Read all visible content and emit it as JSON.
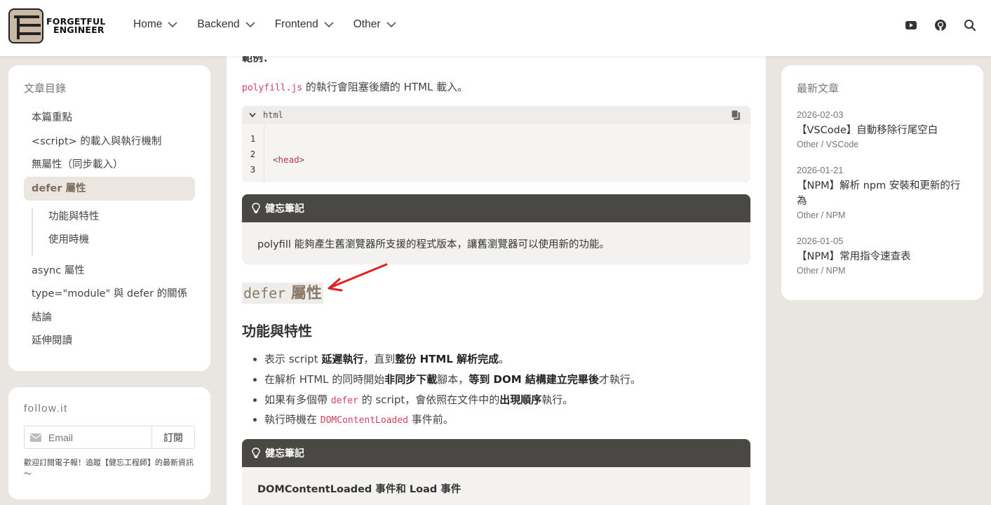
{
  "header": {
    "logo_line1": "FORGETFUL",
    "logo_line2": "ENGINEER",
    "nav": [
      "Home",
      "Backend",
      "Frontend",
      "Other"
    ],
    "icons": [
      "youtube-icon",
      "github-icon",
      "search-icon"
    ]
  },
  "toc": {
    "title": "文章目錄",
    "items": [
      "本篇重點",
      "<script> 的載入與執行機制",
      "無屬性（同步載入）",
      "defer 屬性"
    ],
    "sub_items": [
      "功能與特性",
      "使用時機"
    ],
    "items_after": [
      "async 屬性",
      "type=\"module\" 與 defer 的關係",
      "結論",
      "延伸閱讀"
    ]
  },
  "follow": {
    "title": "follow.it",
    "email_placeholder": "Email",
    "button": "訂閱",
    "note": "歡迎訂閱電子報！追蹤【健忘工程師】的最新資訊～"
  },
  "main": {
    "cut_heading": "範例：",
    "intro_code": "polyfill.js",
    "intro_text": " 的執行會阻塞後續的 HTML 載入。",
    "code_lang": "html",
    "code_line_numbers": [
      "1",
      "2",
      "3"
    ],
    "note1_title": "健忘筆記",
    "note1_body": "polyfill 能夠產生舊瀏覽器所支援的程式版本，讓舊瀏覽器可以使用新的功能。",
    "section_code": "defer",
    "section_text": "屬性",
    "subsection": "功能與特性",
    "bullets": {
      "b1_a": "表示 script ",
      "b1_b": "延遲執行",
      "b1_c": "，直到",
      "b1_d": "整份 HTML 解析完成",
      "b1_e": "。",
      "b2_a": "在解析 HTML 的同時開始",
      "b2_b": "非同步下載",
      "b2_c": "腳本，",
      "b2_d": "等到 DOM 結構建立完畢後",
      "b2_e": "才執行。",
      "b3_a": "如果有多個帶 ",
      "b3_code": "defer",
      "b3_b": " 的 script，會依照在文件中的",
      "b3_c": "出現順序",
      "b3_d": "執行。",
      "b4_a": "執行時機在 ",
      "b4_code": "DOMContentLoaded",
      "b4_b": " 事件前。"
    },
    "note2_title": "健忘筆記",
    "note2_body": "DOMContentLoaded 事件和 Load 事件"
  },
  "recent": {
    "title": "最新文章",
    "posts": [
      {
        "date": "2026-02-03",
        "title": "【VSCode】自動移除行尾空白",
        "cat": "Other / VSCode"
      },
      {
        "date": "2026-01-21",
        "title": "【NPM】解析 npm 安裝和更新的行為",
        "cat": "Other / NPM"
      },
      {
        "date": "2026-01-05",
        "title": "【NPM】常用指令速查表",
        "cat": "Other / NPM"
      }
    ]
  },
  "colors": {
    "accent": "#8a7a68",
    "note_header": "#4a4845",
    "arrow": "#e02020",
    "inline_code": "#d0405a"
  }
}
